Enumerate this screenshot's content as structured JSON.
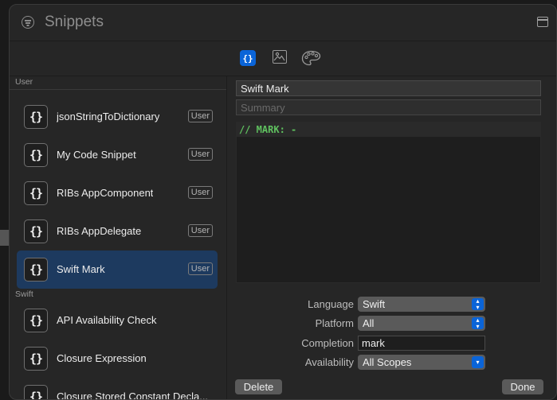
{
  "window": {
    "title": "Snippets"
  },
  "library_tabs": [
    {
      "name": "snippets",
      "icon": "code-braces-icon",
      "label": "{}",
      "selected": true
    },
    {
      "name": "media",
      "icon": "photo-icon",
      "selected": false
    },
    {
      "name": "colors",
      "icon": "palette-icon",
      "selected": false
    }
  ],
  "sidebar": {
    "user_section": "User",
    "user_items": [
      {
        "name": "jsonStringToDictionary",
        "badge": "User"
      },
      {
        "name": "My Code Snippet",
        "badge": "User"
      },
      {
        "name": "RIBs AppComponent",
        "badge": "User"
      },
      {
        "name": "RIBs AppDelegate",
        "badge": "User"
      },
      {
        "name": "Swift Mark",
        "badge": "User",
        "selected": true
      }
    ],
    "swift_section": "Swift",
    "swift_items": [
      {
        "name": "API Availability Check"
      },
      {
        "name": "Closure Expression"
      },
      {
        "name": "Closure Stored Constant Decla..."
      }
    ],
    "icon_glyph": "{}"
  },
  "editor": {
    "name_value": "Swift Mark",
    "summary_placeholder": "Summary",
    "code": "// MARK: -",
    "language_label": "Language",
    "language_value": "Swift",
    "platform_label": "Platform",
    "platform_value": "All",
    "completion_label": "Completion",
    "completion_value": "mark",
    "availability_label": "Availability",
    "availability_value": "All Scopes",
    "delete_label": "Delete",
    "done_label": "Done"
  },
  "colors": {
    "accent": "#0a64d8",
    "selection": "#1d3a5f",
    "code_green": "#5fc15f"
  }
}
